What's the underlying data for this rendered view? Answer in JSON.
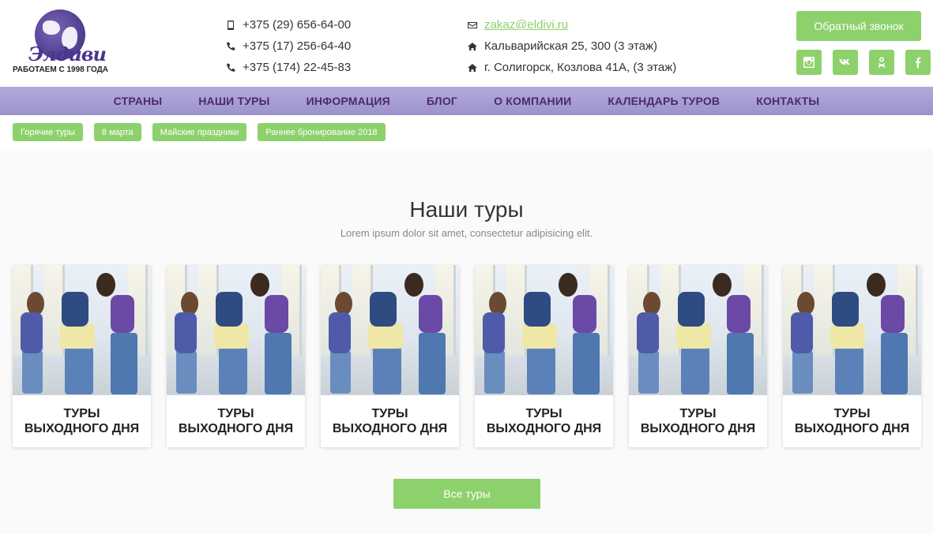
{
  "logo": {
    "brand": "Элдиви",
    "tagline": "РАБОТАЕМ С 1998 ГОДА"
  },
  "contacts": {
    "phones": [
      {
        "icon": "mobile-phone-icon",
        "text": "+375 (29) 656-64-00"
      },
      {
        "icon": "phone-icon",
        "text": "+375 (17) 256-64-40"
      },
      {
        "icon": "phone-icon",
        "text": "+375 (174) 22-45-83"
      }
    ],
    "email": {
      "icon": "envelope-icon",
      "text": "zakaz@eldivi.ru"
    },
    "addresses": [
      {
        "icon": "home-icon",
        "text": "Кальварийская 25, 300 (3 этаж)"
      },
      {
        "icon": "home-icon",
        "text": "г. Солигорск, Козлова 41А, (3 этаж)"
      }
    ]
  },
  "callback_label": "Обратный звонок",
  "socials": [
    "instagram-icon",
    "vk-icon",
    "odnoklassniki-icon",
    "facebook-icon"
  ],
  "nav": [
    "СТРАНЫ",
    "НАШИ ТУРЫ",
    "ИНФОРМАЦИЯ",
    "БЛОГ",
    "О КОМПАНИИ",
    "КАЛЕНДАРЬ ТУРОВ",
    "КОНТАКТЫ"
  ],
  "tags": [
    "Горячие туры",
    "8 марта",
    "Майские праздники",
    "Раннее бронирование 2018"
  ],
  "section": {
    "title": "Наши туры",
    "subtitle": "Lorem ipsum dolor sit amet, consectetur adipisicing elit."
  },
  "cards": [
    {
      "line1": "ТУРЫ",
      "line2": "ВЫХОДНОГО ДНЯ"
    },
    {
      "line1": "ТУРЫ",
      "line2": "ВЫХОДНОГО ДНЯ"
    },
    {
      "line1": "ТУРЫ",
      "line2": "ВЫХОДНОГО ДНЯ"
    },
    {
      "line1": "ТУРЫ",
      "line2": "ВЫХОДНОГО ДНЯ"
    },
    {
      "line1": "ТУРЫ",
      "line2": "ВЫХОДНОГО ДНЯ"
    },
    {
      "line1": "ТУРЫ",
      "line2": "ВЫХОДНОГО ДНЯ"
    }
  ],
  "all_tours_label": "Все туры",
  "colors": {
    "accent": "#8dd16c",
    "nav_bg": "#a69dd2",
    "nav_text": "#4c2a6b",
    "logo": "#4b358e"
  }
}
